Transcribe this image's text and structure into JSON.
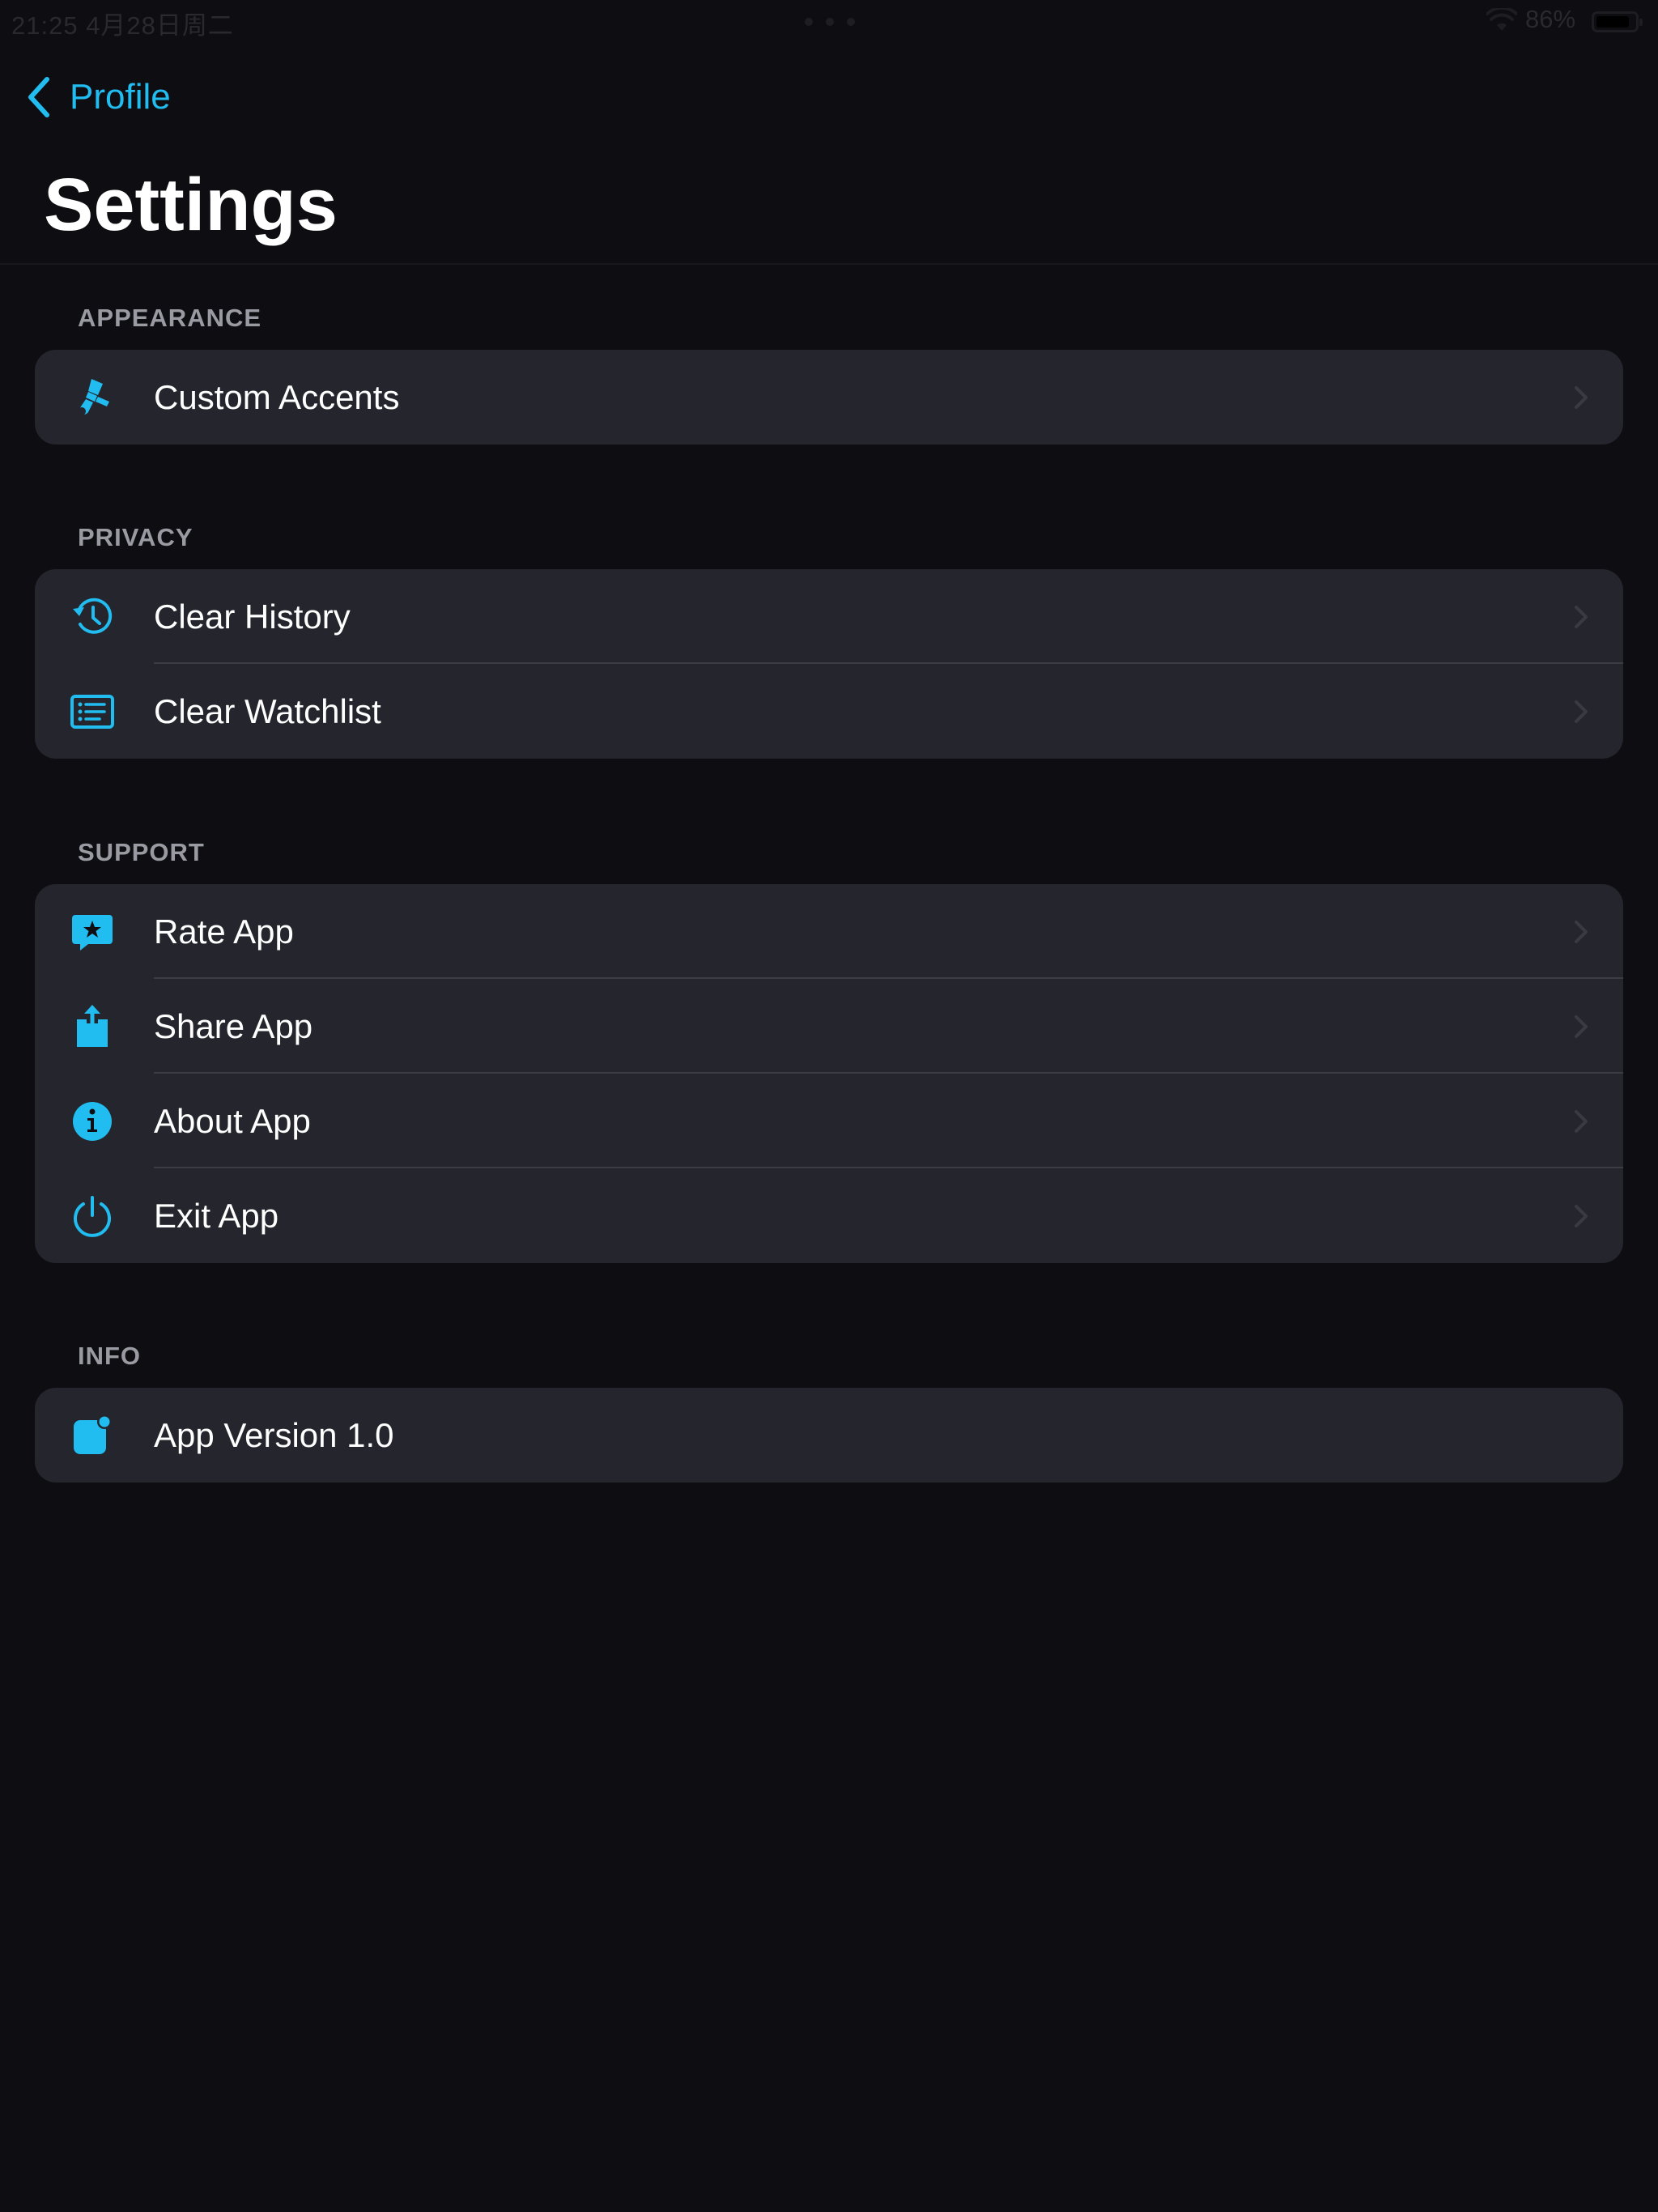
{
  "status_bar": {
    "time": "21:25   4月28日周二",
    "battery_percent": "86%",
    "battery_level": 0.86
  },
  "nav": {
    "back_label": "Profile"
  },
  "page": {
    "title": "Settings"
  },
  "colors": {
    "accent": "#22bdf0",
    "background": "#0e0e12",
    "group_background": "#25252d",
    "section_header": "#9a9aa2"
  },
  "sections": [
    {
      "header": "APPEARANCE",
      "items": [
        {
          "label": "Custom Accents",
          "icon": "paintbrush-icon"
        }
      ]
    },
    {
      "header": "PRIVACY",
      "items": [
        {
          "label": "Clear History",
          "icon": "clock-arrow-icon"
        },
        {
          "label": "Clear Watchlist",
          "icon": "list-icon"
        }
      ]
    },
    {
      "header": "SUPPORT",
      "items": [
        {
          "label": "Rate App",
          "icon": "star-bubble-icon"
        },
        {
          "label": "Share App",
          "icon": "share-icon"
        },
        {
          "label": "About App",
          "icon": "info-icon"
        },
        {
          "label": "Exit App",
          "icon": "power-icon"
        }
      ]
    },
    {
      "header": "INFO",
      "items": [
        {
          "label": "App Version 1.0",
          "icon": "app-badge-icon"
        }
      ]
    }
  ]
}
